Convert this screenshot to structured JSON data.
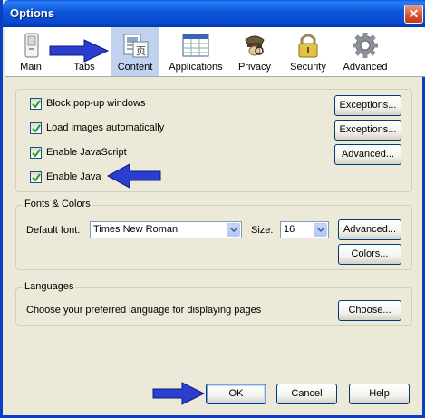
{
  "window": {
    "title": "Options",
    "close_glyph": "✕"
  },
  "tabs": [
    {
      "label": "Main",
      "icon": "main-icon"
    },
    {
      "label": "Tabs",
      "icon": "tabs-icon"
    },
    {
      "label": "Content",
      "icon": "content-icon",
      "selected": true
    },
    {
      "label": "Applications",
      "icon": "applications-icon"
    },
    {
      "label": "Privacy",
      "icon": "privacy-icon"
    },
    {
      "label": "Security",
      "icon": "security-icon"
    },
    {
      "label": "Advanced",
      "icon": "advanced-icon"
    }
  ],
  "content": {
    "block_popups": {
      "label": "Block pop-up windows",
      "checked": true,
      "button": "Exceptions..."
    },
    "load_images": {
      "label": "Load images automatically",
      "checked": true,
      "button": "Exceptions..."
    },
    "javascript": {
      "label": "Enable JavaScript",
      "checked": true,
      "button": "Advanced..."
    },
    "java": {
      "label": "Enable Java",
      "checked": true
    }
  },
  "fonts": {
    "group_title": "Fonts & Colors",
    "default_font_label": "Default font:",
    "default_font_value": "Times New Roman",
    "size_label": "Size:",
    "size_value": "16",
    "advanced_button": "Advanced...",
    "colors_button": "Colors..."
  },
  "languages": {
    "group_title": "Languages",
    "description": "Choose your preferred language for displaying pages",
    "choose_button": "Choose..."
  },
  "footer": {
    "ok": "OK",
    "cancel": "Cancel",
    "help": "Help"
  },
  "colors": {
    "title_bar": "#0b5ded",
    "annotation_arrow": "#2a3fd0",
    "dialog_bg": "#ece9d8"
  }
}
